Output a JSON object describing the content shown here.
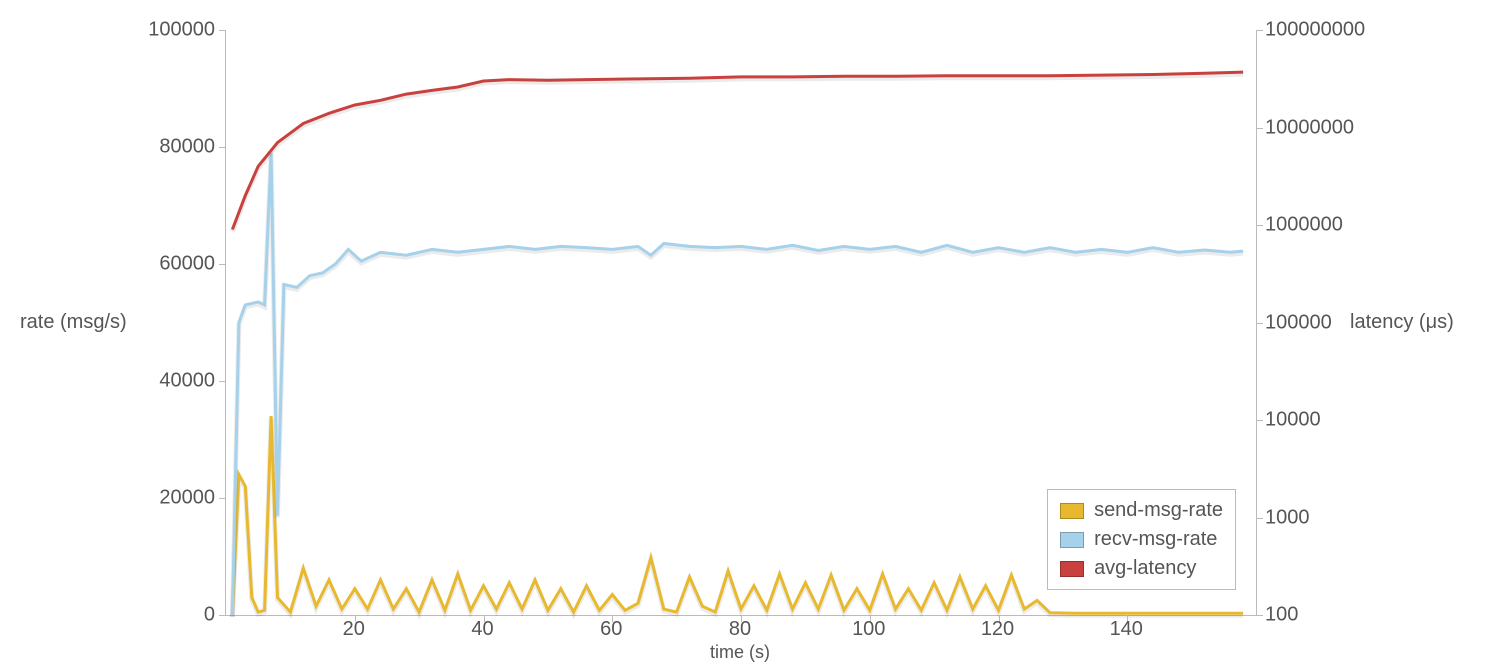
{
  "chart_data": {
    "type": "line",
    "title": "",
    "xlabel": "time (s)",
    "x_range": [
      0,
      160
    ],
    "x_ticks": [
      20,
      40,
      60,
      80,
      100,
      120,
      140
    ],
    "y_left": {
      "label": "rate (msg/s)",
      "scale": "linear",
      "range": [
        0,
        100000
      ],
      "ticks": [
        0,
        20000,
        40000,
        60000,
        80000,
        100000
      ]
    },
    "y_right": {
      "label": "latency (μs)",
      "scale": "log",
      "range": [
        100,
        100000000
      ],
      "ticks": [
        100,
        1000,
        10000,
        100000,
        1000000,
        10000000,
        100000000
      ]
    },
    "legend": {
      "position": "bottom-right",
      "items": [
        {
          "name": "send-msg-rate",
          "color": "#e8b92e"
        },
        {
          "name": "recv-msg-rate",
          "color": "#a6d1ea"
        },
        {
          "name": "avg-latency",
          "color": "#c9413f"
        }
      ]
    },
    "series": [
      {
        "name": "send-msg-rate",
        "axis": "left",
        "color": "#e8b92e",
        "data": [
          {
            "x": 1,
            "y": 0
          },
          {
            "x": 2,
            "y": 24000
          },
          {
            "x": 3,
            "y": 22000
          },
          {
            "x": 4,
            "y": 3000
          },
          {
            "x": 5,
            "y": 500
          },
          {
            "x": 6,
            "y": 800
          },
          {
            "x": 7,
            "y": 34000
          },
          {
            "x": 8,
            "y": 3000
          },
          {
            "x": 10,
            "y": 500
          },
          {
            "x": 12,
            "y": 8000
          },
          {
            "x": 14,
            "y": 1500
          },
          {
            "x": 16,
            "y": 6000
          },
          {
            "x": 18,
            "y": 1000
          },
          {
            "x": 20,
            "y": 4500
          },
          {
            "x": 22,
            "y": 1000
          },
          {
            "x": 24,
            "y": 6000
          },
          {
            "x": 26,
            "y": 1000
          },
          {
            "x": 28,
            "y": 4500
          },
          {
            "x": 30,
            "y": 500
          },
          {
            "x": 32,
            "y": 6000
          },
          {
            "x": 34,
            "y": 800
          },
          {
            "x": 36,
            "y": 7000
          },
          {
            "x": 38,
            "y": 800
          },
          {
            "x": 40,
            "y": 5000
          },
          {
            "x": 42,
            "y": 1000
          },
          {
            "x": 44,
            "y": 5500
          },
          {
            "x": 46,
            "y": 1000
          },
          {
            "x": 48,
            "y": 6000
          },
          {
            "x": 50,
            "y": 800
          },
          {
            "x": 52,
            "y": 4500
          },
          {
            "x": 54,
            "y": 500
          },
          {
            "x": 56,
            "y": 5000
          },
          {
            "x": 58,
            "y": 800
          },
          {
            "x": 60,
            "y": 3500
          },
          {
            "x": 62,
            "y": 800
          },
          {
            "x": 64,
            "y": 2000
          },
          {
            "x": 66,
            "y": 9800
          },
          {
            "x": 68,
            "y": 1000
          },
          {
            "x": 70,
            "y": 500
          },
          {
            "x": 72,
            "y": 6500
          },
          {
            "x": 74,
            "y": 1500
          },
          {
            "x": 76,
            "y": 500
          },
          {
            "x": 78,
            "y": 7500
          },
          {
            "x": 80,
            "y": 1000
          },
          {
            "x": 82,
            "y": 5000
          },
          {
            "x": 84,
            "y": 800
          },
          {
            "x": 86,
            "y": 7000
          },
          {
            "x": 88,
            "y": 1000
          },
          {
            "x": 90,
            "y": 5500
          },
          {
            "x": 92,
            "y": 1000
          },
          {
            "x": 94,
            "y": 6800
          },
          {
            "x": 96,
            "y": 800
          },
          {
            "x": 98,
            "y": 4500
          },
          {
            "x": 100,
            "y": 800
          },
          {
            "x": 102,
            "y": 7000
          },
          {
            "x": 104,
            "y": 1000
          },
          {
            "x": 106,
            "y": 4500
          },
          {
            "x": 108,
            "y": 800
          },
          {
            "x": 110,
            "y": 5500
          },
          {
            "x": 112,
            "y": 800
          },
          {
            "x": 114,
            "y": 6500
          },
          {
            "x": 116,
            "y": 1000
          },
          {
            "x": 118,
            "y": 5000
          },
          {
            "x": 120,
            "y": 800
          },
          {
            "x": 122,
            "y": 6800
          },
          {
            "x": 124,
            "y": 1000
          },
          {
            "x": 126,
            "y": 2500
          },
          {
            "x": 128,
            "y": 400
          },
          {
            "x": 132,
            "y": 300
          },
          {
            "x": 140,
            "y": 300
          },
          {
            "x": 150,
            "y": 300
          },
          {
            "x": 158,
            "y": 300
          }
        ]
      },
      {
        "name": "recv-msg-rate",
        "axis": "left",
        "color": "#a6d1ea",
        "data": [
          {
            "x": 1,
            "y": 0
          },
          {
            "x": 2,
            "y": 50000
          },
          {
            "x": 3,
            "y": 53000
          },
          {
            "x": 5,
            "y": 53500
          },
          {
            "x": 6,
            "y": 53000
          },
          {
            "x": 7,
            "y": 79000
          },
          {
            "x": 8,
            "y": 17000
          },
          {
            "x": 9,
            "y": 56500
          },
          {
            "x": 11,
            "y": 56000
          },
          {
            "x": 13,
            "y": 58000
          },
          {
            "x": 15,
            "y": 58500
          },
          {
            "x": 17,
            "y": 60000
          },
          {
            "x": 19,
            "y": 62500
          },
          {
            "x": 21,
            "y": 60500
          },
          {
            "x": 24,
            "y": 62000
          },
          {
            "x": 28,
            "y": 61500
          },
          {
            "x": 32,
            "y": 62500
          },
          {
            "x": 36,
            "y": 62000
          },
          {
            "x": 40,
            "y": 62500
          },
          {
            "x": 44,
            "y": 63000
          },
          {
            "x": 48,
            "y": 62500
          },
          {
            "x": 52,
            "y": 63000
          },
          {
            "x": 56,
            "y": 62800
          },
          {
            "x": 60,
            "y": 62500
          },
          {
            "x": 64,
            "y": 63000
          },
          {
            "x": 66,
            "y": 61500
          },
          {
            "x": 68,
            "y": 63500
          },
          {
            "x": 72,
            "y": 63000
          },
          {
            "x": 76,
            "y": 62800
          },
          {
            "x": 80,
            "y": 63000
          },
          {
            "x": 84,
            "y": 62500
          },
          {
            "x": 88,
            "y": 63200
          },
          {
            "x": 92,
            "y": 62300
          },
          {
            "x": 96,
            "y": 63000
          },
          {
            "x": 100,
            "y": 62500
          },
          {
            "x": 104,
            "y": 63000
          },
          {
            "x": 108,
            "y": 62000
          },
          {
            "x": 112,
            "y": 63200
          },
          {
            "x": 116,
            "y": 62000
          },
          {
            "x": 120,
            "y": 62800
          },
          {
            "x": 124,
            "y": 62000
          },
          {
            "x": 128,
            "y": 62800
          },
          {
            "x": 132,
            "y": 62000
          },
          {
            "x": 136,
            "y": 62500
          },
          {
            "x": 140,
            "y": 62000
          },
          {
            "x": 144,
            "y": 62800
          },
          {
            "x": 148,
            "y": 62000
          },
          {
            "x": 152,
            "y": 62400
          },
          {
            "x": 156,
            "y": 62000
          },
          {
            "x": 158,
            "y": 62200
          }
        ]
      },
      {
        "name": "avg-latency",
        "axis": "right",
        "color": "#c9413f",
        "data": [
          {
            "x": 1,
            "y": 900000
          },
          {
            "x": 3,
            "y": 2000000
          },
          {
            "x": 5,
            "y": 4000000
          },
          {
            "x": 8,
            "y": 7000000
          },
          {
            "x": 12,
            "y": 11000000
          },
          {
            "x": 16,
            "y": 14000000
          },
          {
            "x": 20,
            "y": 17000000
          },
          {
            "x": 24,
            "y": 19000000
          },
          {
            "x": 28,
            "y": 22000000
          },
          {
            "x": 32,
            "y": 24000000
          },
          {
            "x": 36,
            "y": 26000000
          },
          {
            "x": 40,
            "y": 30000000
          },
          {
            "x": 44,
            "y": 31000000
          },
          {
            "x": 50,
            "y": 30500000
          },
          {
            "x": 56,
            "y": 31000000
          },
          {
            "x": 64,
            "y": 31500000
          },
          {
            "x": 72,
            "y": 32000000
          },
          {
            "x": 80,
            "y": 33000000
          },
          {
            "x": 88,
            "y": 33000000
          },
          {
            "x": 96,
            "y": 33500000
          },
          {
            "x": 104,
            "y": 33500000
          },
          {
            "x": 112,
            "y": 34000000
          },
          {
            "x": 120,
            "y": 34000000
          },
          {
            "x": 128,
            "y": 34000000
          },
          {
            "x": 136,
            "y": 34500000
          },
          {
            "x": 144,
            "y": 35000000
          },
          {
            "x": 152,
            "y": 36000000
          },
          {
            "x": 158,
            "y": 37000000
          }
        ]
      }
    ]
  }
}
